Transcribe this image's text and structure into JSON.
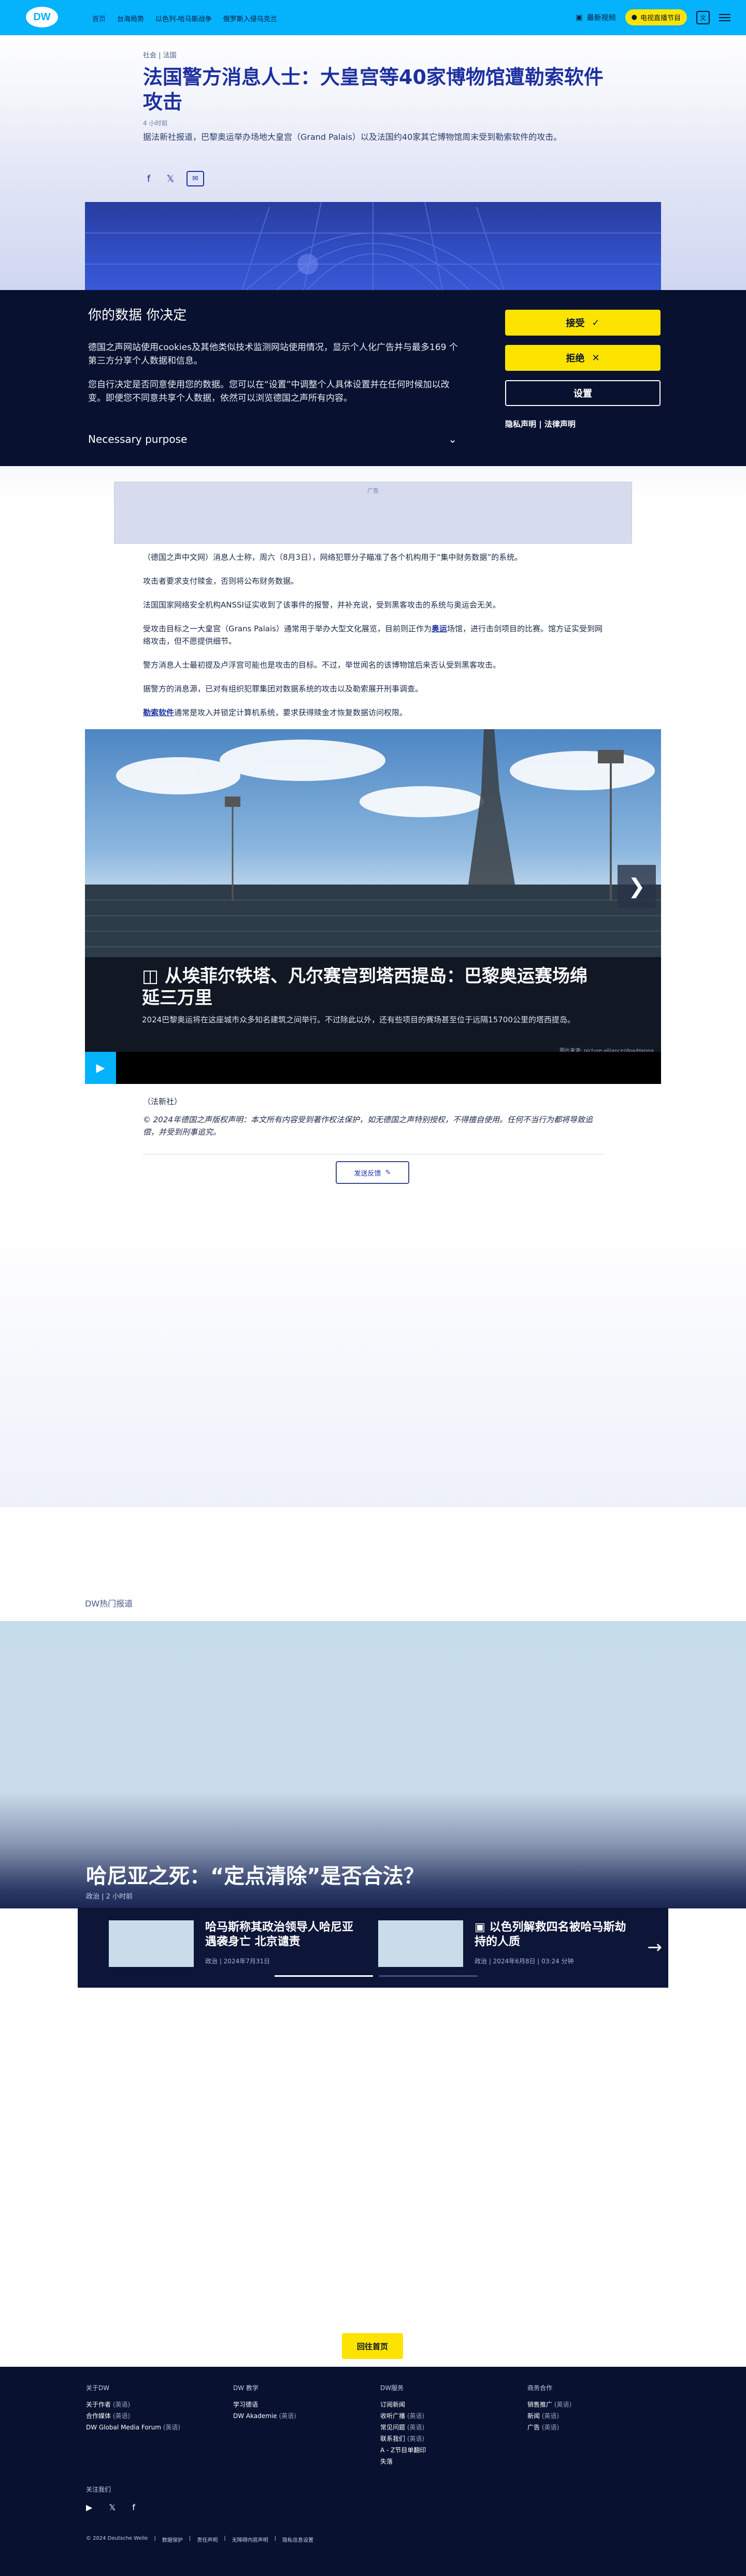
{
  "header": {
    "logo": "DW",
    "nav": [
      "首页",
      "台海局势",
      "以色列-哈马斯战争",
      "俄罗斯入侵乌克兰"
    ],
    "latest_video": "最新视频",
    "tv_button": "电视直播节目",
    "lang_button": "文"
  },
  "article": {
    "breadcrumb": "社会 | 法国",
    "title": "法国警方消息人士：大皇宫等40家博物馆遭勒索软件攻击",
    "time_ago": "4 小时前",
    "lead": "据法新社报道，巴黎奥运举办场地大皇宫（Grand Palais）以及法国约40家其它博物馆周末受到勒索软件的攻击。"
  },
  "consent": {
    "title": "你的数据 你决定",
    "p1": "德国之声网站使用cookies及其他类似技术监测网站使用情况，显示个人化广告并与最多169 个第三方分享个人数据和信息。",
    "p2": "您自行决定是否同意使用您的数据。您可以在“设置”中调整个人具体设置并在任何时候加以改变。即便您不同意共享个人数据，依然可以浏览德国之声所有内容。",
    "purpose": "Necessary purpose",
    "accept": "接受",
    "reject": "拒绝",
    "settings": "设置",
    "links": "隐私声明 | 法律声明"
  },
  "ad": {
    "label": "广告"
  },
  "body": {
    "p1": "（德国之声中文网）消息人士称，周六（8月3日），网络犯罪分子瞄准了各个机构用于“集中财务数据”的系统。",
    "p2": "攻击者要求支付赎金，否则将公布财务数据。",
    "p3": "法国国家网络安全机构ANSSI证实收到了该事件的报警，并补充说，受到黑客攻击的系统与奥运会无关。",
    "p4_a": "受攻击目标之一大皇宫（Grans Palais）通常用于举办大型文化展览，目前则正作为",
    "p4_link": "奥运",
    "p4_b": "场馆，进行击剑项目的比赛。馆方证实受到网络攻击，但不愿提供细节。",
    "p5": "警方消息人士最初提及卢浮宫可能也是攻击的目标。不过，举世闻名的该博物馆后来否认受到黑客攻击。",
    "p6": "据警方的消息源，已对有组织犯罪集团对数据系统的攻击以及勒索展开刑事调查。",
    "p7_link": "勒索软件",
    "p7_b": "通常是攻入并锁定计算机系统，要求获得赎金才恢复数据访问权限。"
  },
  "gallery": {
    "title": "从埃菲尔铁塔、凡尔赛宫到塔西提岛：巴黎奥运赛场绵延三万里",
    "subtitle": "2024巴黎奥运将在这座城市众多知名建筑之间举行。不过除此以外，还有些项目的赛场甚至位于远隔15700公里的塔西提岛。",
    "credit": "图片来源: picture-alliance/dpa/Hanna"
  },
  "footer_article": {
    "source": "（法新社）",
    "copyright": "© 2024年德国之声版权声明：本文所有内容受到著作权法保护，如无德国之声特别授权，不得擅自使用。任何不当行为都将导致追偿，并受到刑事追究。",
    "feedback": "发送反馈"
  },
  "hot": {
    "label": "DW热门报道",
    "feature_title": "哈尼亚之死：“定点清除”是否合法？",
    "feature_meta": "政治 | 2 小时前",
    "items": [
      {
        "title": "哈马斯称其政治领导人哈尼亚遇袭身亡 北京谴责",
        "meta": "政治 | 2024年7月31日"
      },
      {
        "title": "以色列解救四名被哈马斯劫持的人质",
        "meta": "政治 | 2024年6月8日 | 03:24 分钟"
      }
    ]
  },
  "back_to_top": "回往首页",
  "footer": {
    "cols": [
      {
        "title": "关于DW",
        "items": [
          [
            "关于作者",
            "(英语)"
          ],
          [
            "合作媒体",
            "(英语)"
          ],
          [
            "DW Global Media Forum",
            "(英语)"
          ]
        ]
      },
      {
        "title": "DW 教学",
        "items": [
          [
            "学习德语",
            ""
          ],
          [
            "DW Akademie",
            "(英语)"
          ]
        ]
      },
      {
        "title": "DW服务",
        "items": [
          [
            "订阅新闻",
            ""
          ],
          [
            "收听广播",
            "(英语)"
          ],
          [
            "常见问题",
            "(英语)"
          ],
          [
            "联系我们",
            "(英语)"
          ],
          [
            "A - Z节目单翻印",
            ""
          ],
          [
            "失落",
            ""
          ]
        ]
      },
      {
        "title": "商务合作",
        "items": [
          [
            "销售推广",
            "(英语)"
          ],
          [
            "新闻",
            "(英语)"
          ],
          [
            "广告",
            "(英语)"
          ]
        ]
      }
    ],
    "follow": "关注我们",
    "bottom": [
      "© 2024 Deutsche Welle",
      "数据保护",
      "责任声明",
      "无障碍内容声明",
      "隐私信息设置"
    ]
  }
}
